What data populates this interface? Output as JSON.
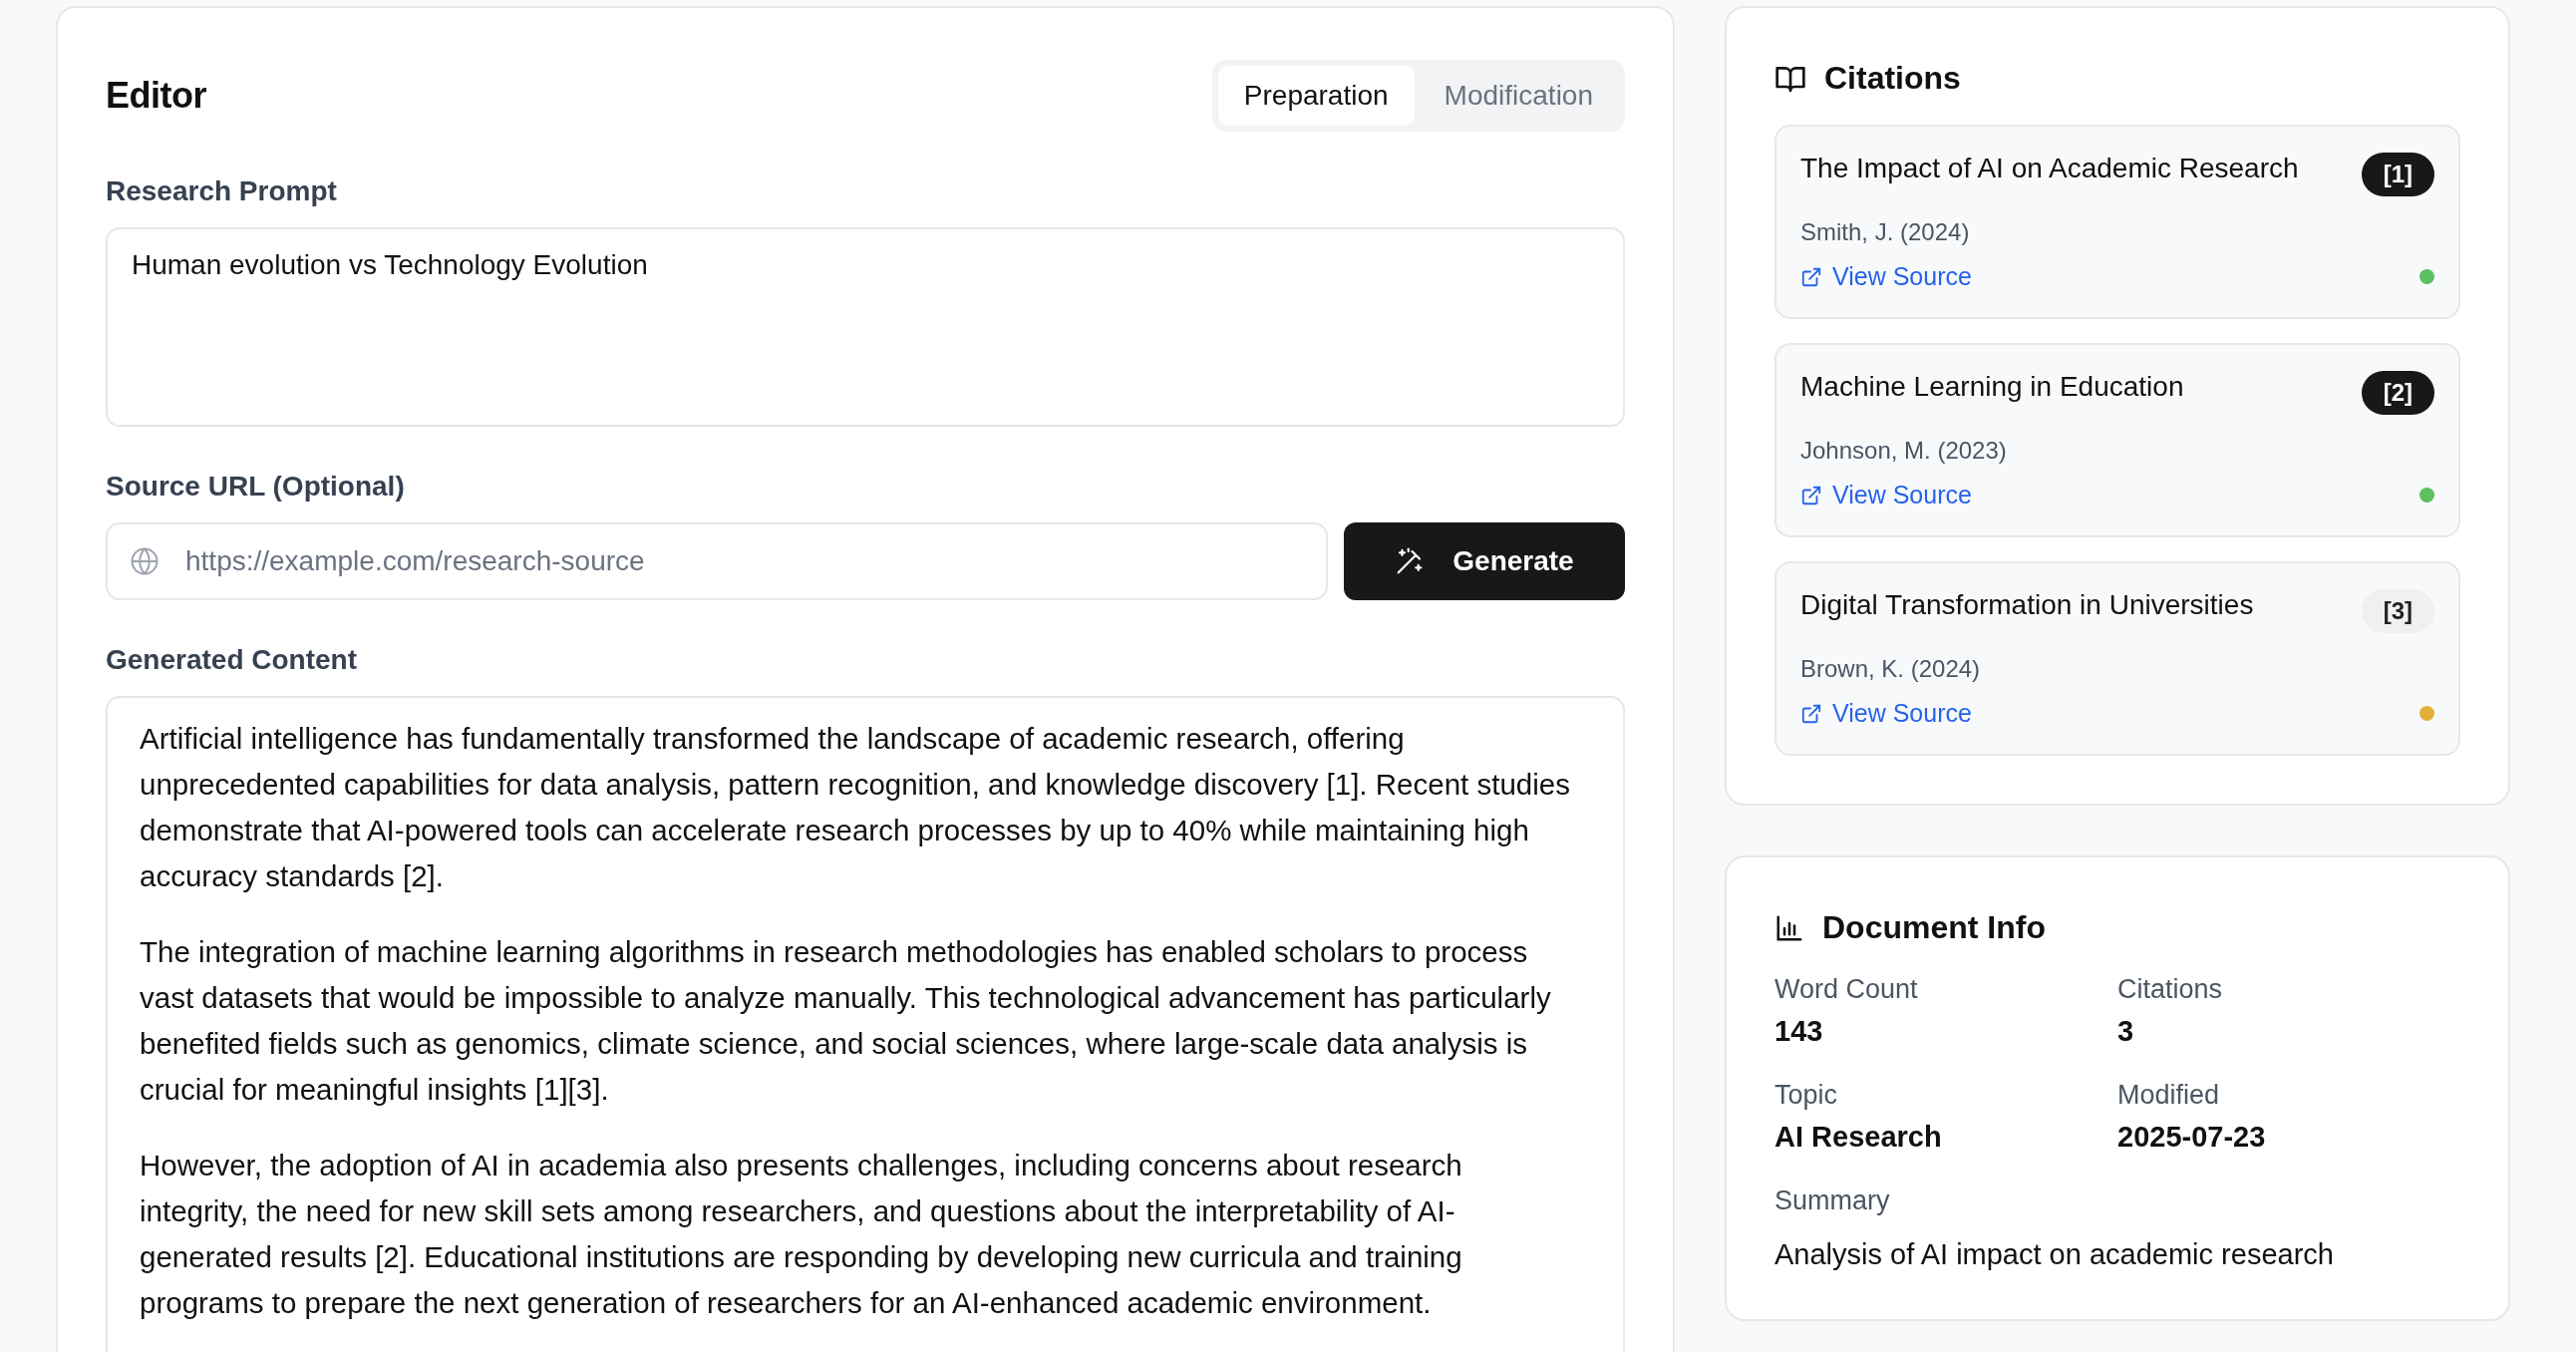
{
  "editor": {
    "title": "Editor",
    "tabs": [
      {
        "label": "Preparation",
        "selected": true
      },
      {
        "label": "Modification",
        "selected": false
      }
    ],
    "prompt": {
      "label": "Research Prompt",
      "value": "Human evolution vs Technology Evolution"
    },
    "source_url": {
      "label": "Source URL (Optional)",
      "placeholder": "https://example.com/research-source"
    },
    "generate_button": "Generate",
    "generated": {
      "label": "Generated Content",
      "paragraphs": [
        "Artificial intelligence has fundamentally transformed the landscape of academic research, offering unprecedented capabilities for data analysis, pattern recognition, and knowledge discovery [1]. Recent studies demonstrate that AI-powered tools can accelerate research processes by up to 40% while maintaining high accuracy standards [2].",
        "The integration of machine learning algorithms in research methodologies has enabled scholars to process vast datasets that would be impossible to analyze manually. This technological advancement has particularly benefited fields such as genomics, climate science, and social sciences, where large-scale data analysis is crucial for meaningful insights [1][3].",
        "However, the adoption of AI in academia also presents challenges, including concerns about research integrity, the need for new skill sets among researchers, and questions about the interpretability of AI-generated results [2]. Educational institutions are responding by developing new curricula and training programs to prepare the next generation of researchers for an AI-enhanced academic environment."
      ]
    }
  },
  "citations": {
    "title": "Citations",
    "items": [
      {
        "title": "The Impact of AI on Academic Research",
        "badge": "[1]",
        "highlighted": true,
        "author": "Smith, J. (2024)",
        "link": "View Source",
        "color": "#5cbf60"
      },
      {
        "title": "Machine Learning in Education",
        "badge": "[2]",
        "highlighted": true,
        "author": "Johnson, M. (2023)",
        "link": "View Source",
        "color": "#5cbf60"
      },
      {
        "title": "Digital Transformation in Universities",
        "badge": "[3]",
        "highlighted": false,
        "author": "Brown, K. (2024)",
        "link": "View Source",
        "color": "#e3b03a"
      }
    ]
  },
  "document_info": {
    "title": "Document Info",
    "fields": [
      {
        "label": "Word Count",
        "value": "143"
      },
      {
        "label": "Citations",
        "value": "3"
      },
      {
        "label": "Topic",
        "value": "AI Research"
      },
      {
        "label": "Modified",
        "value": "2025-07-23"
      }
    ],
    "summary": {
      "label": "Summary",
      "value": "Analysis of AI impact on academic research"
    }
  }
}
